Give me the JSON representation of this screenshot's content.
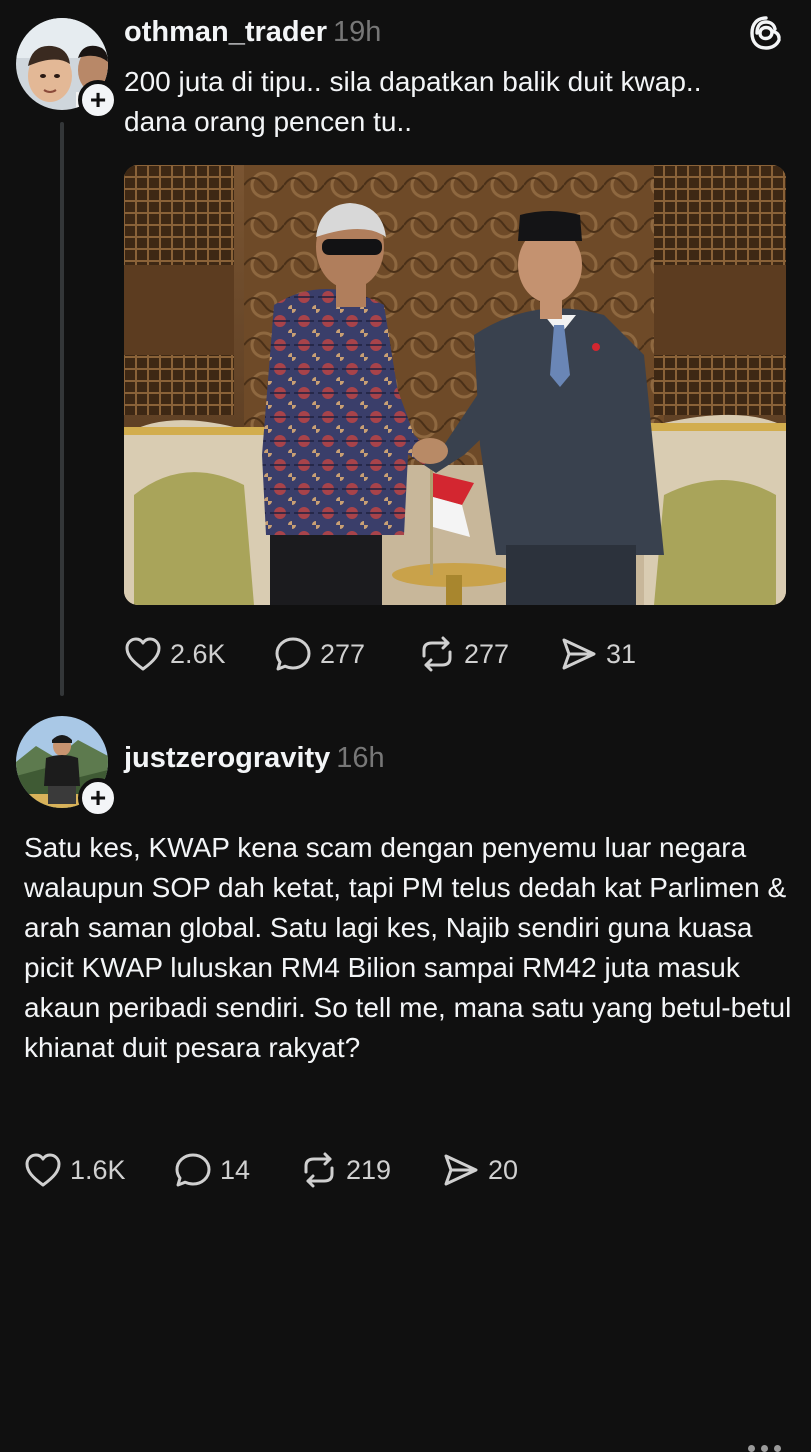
{
  "post1": {
    "username": "othman_trader",
    "time": "19h",
    "text": "200 juta di tipu.. sila dapatkan balik duit kwap.. dana orang pencen tu..",
    "stats": {
      "likes": "2.6K",
      "replies": "277",
      "reposts": "277",
      "shares": "31"
    }
  },
  "post2": {
    "username": "justzerogravity",
    "time": "16h",
    "text": "Satu kes, KWAP kena scam dengan penyemu luar negara walaupun SOP dah ketat, tapi PM telus dedah kat Parlimen & arah saman global. Satu lagi kes, Najib sendiri guna kuasa picit KWAP luluskan RM4 Bilion sampai RM42 juta masuk akaun peribadi sendiri. So tell me, mana satu yang betul-betul khianat duit pesara rakyat?",
    "stats": {
      "likes": "1.6K",
      "replies": "14",
      "reposts": "219",
      "shares": "20"
    }
  },
  "icons": {
    "logo": "threads-logo-icon",
    "like": "heart-icon",
    "reply": "speech-bubble-icon",
    "repost": "repost-icon",
    "share": "paper-plane-icon",
    "follow": "plus-icon",
    "more": "ellipsis-icon"
  },
  "colors": {
    "background": "#101010",
    "text": "#f3f5f7",
    "secondary": "#777777"
  }
}
